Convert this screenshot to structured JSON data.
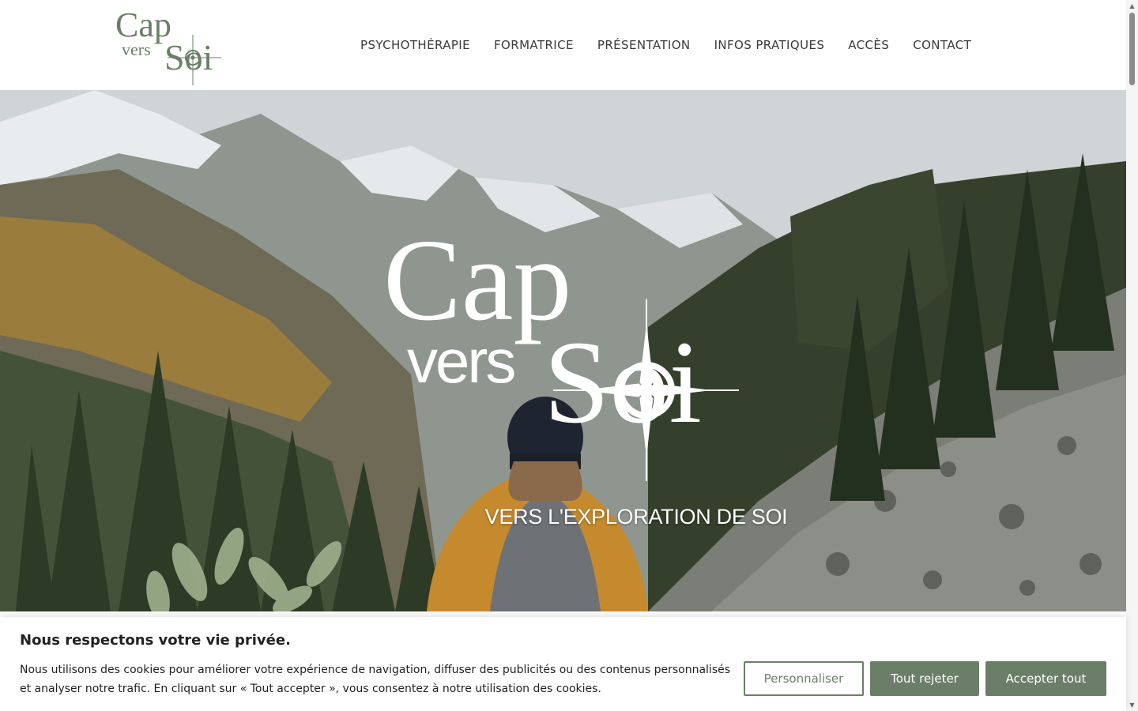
{
  "brand": {
    "logo_line1": "Cap",
    "logo_line2": "vers",
    "logo_line3": "Soi",
    "color_logo": "#6b7f68"
  },
  "nav": {
    "items": [
      {
        "label": "PSYCHOTHÉRAPIE"
      },
      {
        "label": "FORMATRICE"
      },
      {
        "label": "PRÉSENTATION"
      },
      {
        "label": "INFOS PRATIQUES"
      },
      {
        "label": "ACCÈS"
      },
      {
        "label": "CONTACT"
      }
    ]
  },
  "hero": {
    "logo_line1": "Cap",
    "logo_line2": "vers",
    "logo_line3": "Soi",
    "tagline": "VERS L'EXPLORATION DE SOI"
  },
  "cookie_banner": {
    "title": "Nous respectons votre vie privée.",
    "text": "Nous utilisons des cookies pour améliorer votre expérience de navigation, diffuser des publicités ou des contenus personnalisés et analyser notre trafic. En cliquant sur « Tout accepter », vous consentez à notre utilisation des cookies.",
    "customize_label": "Personnaliser",
    "reject_label": "Tout rejeter",
    "accept_label": "Accepter tout",
    "accent_color": "#6b7f68"
  }
}
